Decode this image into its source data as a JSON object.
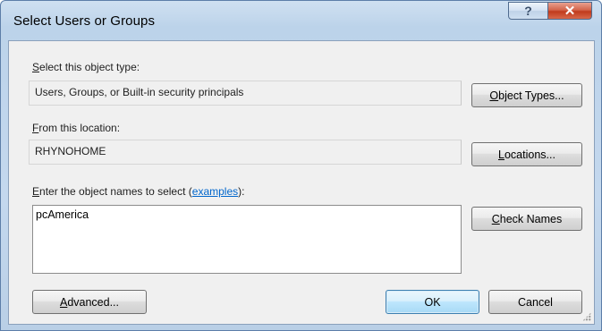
{
  "window": {
    "title": "Select Users or Groups",
    "help_glyph": "?",
    "close_glyph": "✕"
  },
  "object_type": {
    "label_prefix": "",
    "label_access": "S",
    "label_rest": "elect this object type:",
    "value": "Users, Groups, or Built-in security principals",
    "button_access": "O",
    "button_rest": "bject Types..."
  },
  "location": {
    "label_access": "F",
    "label_rest": "rom this location:",
    "value": "RHYNOHOME",
    "button_prefix": "",
    "button_access": "L",
    "button_rest": "ocations..."
  },
  "names": {
    "label_access": "E",
    "label_rest": "nter the object names to select (",
    "link_text": "examples",
    "label_end": "):",
    "value": "pcAmerica",
    "check_access": "C",
    "check_rest": "heck Names"
  },
  "footer": {
    "advanced_access": "A",
    "advanced_rest": "dvanced...",
    "ok_label": "OK",
    "cancel_label": "Cancel"
  },
  "colors": {
    "link": "#0066cc",
    "default_button_border": "#3c7fb1",
    "close_button": "#c03a1c"
  }
}
